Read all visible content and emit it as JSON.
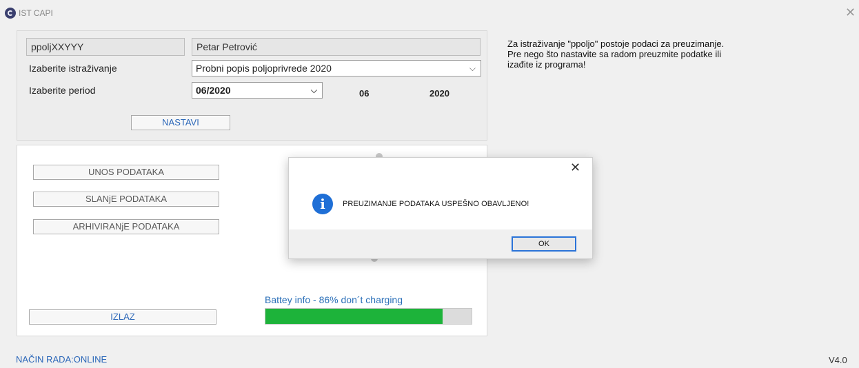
{
  "window": {
    "title": "IST CAPI",
    "close_glyph": "✕"
  },
  "top": {
    "user_code": "ppoljXXYYY",
    "user_name": "Petar Petrović",
    "survey_label": "Izaberite istraživanje",
    "survey_value": "Probni popis poljoprivrede 2020",
    "period_label": "Izaberite period",
    "period_value": "06/2020",
    "period_month": "06",
    "period_year": "2020",
    "continue_label": "NASTAVI"
  },
  "menu": {
    "entry_label": "UNOS PODATAKA",
    "send_label": "SLANjE PODATAKA",
    "archive_label": "ARHIVIRANjE PODATAKA",
    "exit_label": "IZLAZ"
  },
  "battery": {
    "text": "Battey info - 86% don´t charging",
    "level": 0.86,
    "fill_color": "#1db33a"
  },
  "info": {
    "line1": "Za istraživanje \"ppoljo\" postoje podaci za preuzimanje.",
    "line2": "Pre nego što nastavite sa radom preuzmite podatke ili",
    "line3": "izađite iz programa!"
  },
  "footer": {
    "mode": "NAČIN RADA:ONLINE",
    "version": "V4.0"
  },
  "dialog": {
    "message": "PREUZIMANJE PODATAKA USPEŠNO OBAVLJENO!",
    "ok_label": "OK",
    "close_glyph": "✕",
    "icon_glyph": "i"
  }
}
